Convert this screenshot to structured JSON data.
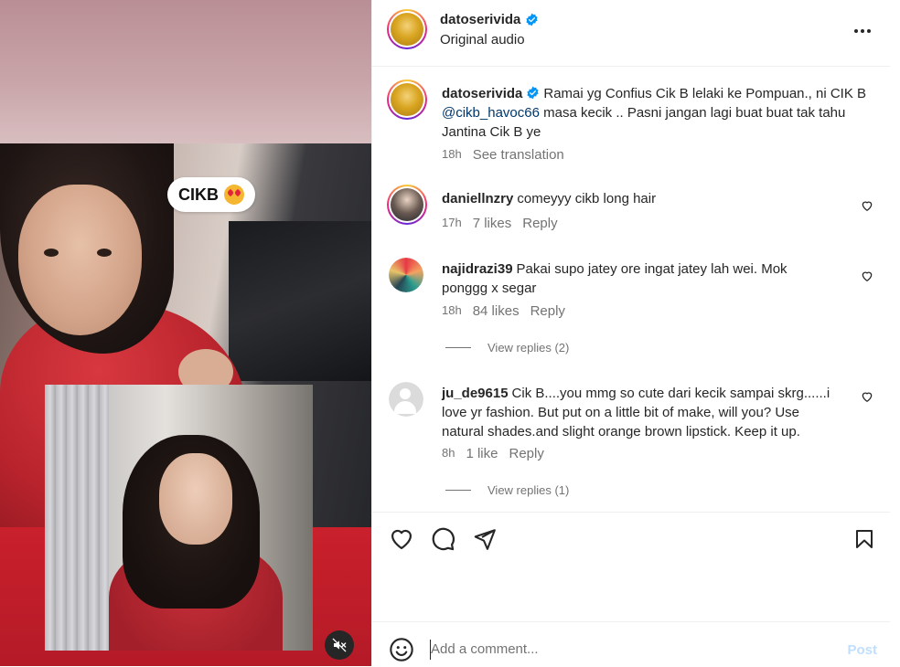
{
  "media": {
    "sticker_text": "CIKB",
    "sticker_emoji_icon": "heart-eyes-emoji-icon",
    "mute_icon": "speaker-muted-icon"
  },
  "header": {
    "username": "datoserivida",
    "subtitle": "Original audio",
    "more_icon": "more-horizontal-icon"
  },
  "caption": {
    "username": "datoserivida",
    "text_before": "Ramai yg Confius Cik B lelaki ke Pompuan., ni CIK B ",
    "mention": "@cikb_havoc66",
    "text_after": " masa kecik .. Pasni jangan lagi buat buat tak tahu Jantina Cik B ye",
    "time": "18h",
    "see_translation": "See translation"
  },
  "comments": [
    {
      "username": "daniellnzry",
      "text": "comeyyy cikb long hair",
      "time": "17h",
      "likes": "7 likes",
      "reply": "Reply"
    },
    {
      "username": "najidrazi39",
      "text": "Pakai supo jatey ore ingat jatey lah wei. Mok ponggg x segar",
      "time": "18h",
      "likes": "84 likes",
      "reply": "Reply",
      "view_replies": "View replies (2)"
    },
    {
      "username": "ju_de9615",
      "text": "Cik B....you mmg so cute dari kecik sampai skrg......i love yr fashion. But put on a little bit of make, will you? Use natural shades.and slight orange brown lipstick. Keep it up.",
      "time": "8h",
      "likes": "1 like",
      "reply": "Reply",
      "view_replies": "View replies (1)"
    }
  ],
  "actions": {
    "like_icon": "heart-icon",
    "comment_icon": "comment-icon",
    "share_icon": "share-icon",
    "save_icon": "bookmark-icon"
  },
  "add_comment": {
    "placeholder": "Add a comment...",
    "post_label": "Post",
    "emoji_icon": "emoji-icon"
  },
  "colors": {
    "verified": "#0095f6",
    "mention": "#00376b",
    "muted_text": "#737373",
    "post_disabled": "#c0dffd"
  }
}
